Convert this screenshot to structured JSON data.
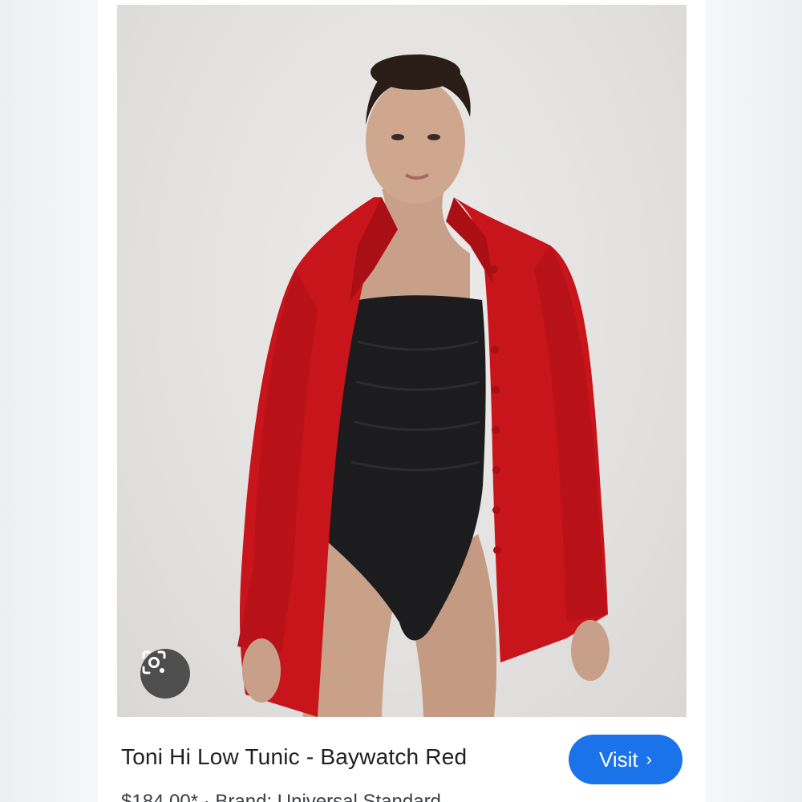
{
  "result": {
    "title": "Toni Hi Low Tunic - Baywatch Red",
    "visit_label": "Visit",
    "visit_chevron": "›",
    "subline": "$184.00* · Brand: Universal Standard"
  },
  "icons": {
    "lens": "google-lens-icon",
    "chevron": "chevron-right-icon"
  },
  "colors": {
    "accent": "#1a73e8",
    "shirt_red": "#c8141b",
    "swimsuit": "#1c1c1f"
  }
}
